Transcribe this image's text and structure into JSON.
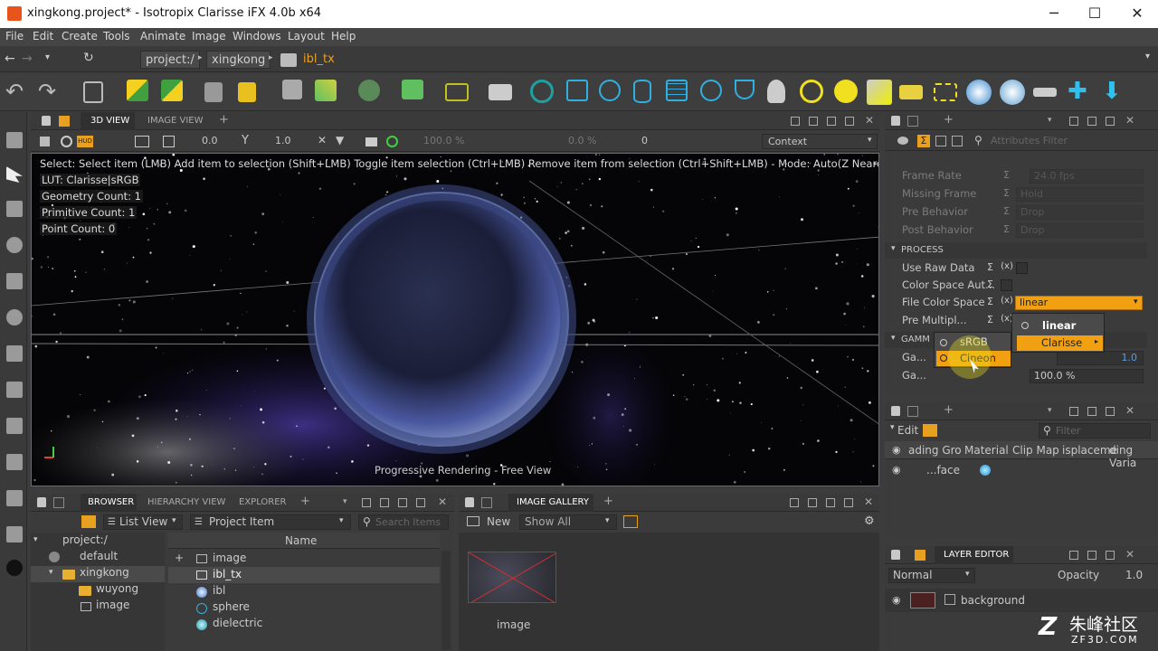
{
  "window": {
    "title": "xingkong.project* - Isotropix Clarisse iFX 4.0b x64",
    "minimize": "─",
    "maximize": "☐",
    "close": "✕"
  },
  "menu": [
    "File",
    "Edit",
    "Create",
    "Tools",
    "Animate",
    "Image",
    "Windows",
    "Layout",
    "Help"
  ],
  "breadcrumb": {
    "root": "project:/",
    "folder": "xingkong",
    "item": "ibl_tx"
  },
  "viewport_panel": {
    "tabs": [
      "3D VIEW",
      "IMAGE VIEW"
    ],
    "active_tab": "3D VIEW"
  },
  "viewbar": {
    "val1": "0.0",
    "val2": "1.0",
    "zoom": "100.0 %",
    "pct": "0.0 %",
    "frame": "0",
    "context": "Context"
  },
  "viewport": {
    "hint": "Select: Select item (LMB)  Add item to selection (Shift+LMB)  Toggle item selection (Ctrl+LMB)  Remove item from selection (Ctrl+Shift+LMB)  - Mode: Auto(Z Nearest) - Chang",
    "lut": "LUT: Clarisse|sRGB",
    "geometry_count": "Geometry Count: 1",
    "primitive_count": "Primitive Count: 1",
    "point_count": "Point Count: 0",
    "status": "Progressive Rendering - Free View"
  },
  "attributes": {
    "filter_placeholder": "Attributes Filter",
    "rows_top": [
      {
        "label": "Frame Rate",
        "value": "24.0 fps"
      },
      {
        "label": "Missing Frame",
        "value": "Hold"
      },
      {
        "label": "Pre Behavior",
        "value": "Drop"
      },
      {
        "label": "Post Behavior",
        "value": "Drop"
      }
    ],
    "process_header": "PROCESS",
    "use_raw_data": "Use Raw Data",
    "color_space_auto": "Color Space Aut...",
    "file_color_space": "File Color Space",
    "file_color_space_value": "linear",
    "pre_multiplied": "Pre Multipl...",
    "gamma_header": "GAMM",
    "gamma1": "Ga...",
    "gamma2": "Ga...",
    "gamma_value": "1.0",
    "percent_value": "100.0 %",
    "sigma": "Σ",
    "x_mark": "(x)"
  },
  "dropdown_main": {
    "items": [
      "linear",
      "Clarisse"
    ],
    "selected": "linear",
    "highlight": "Clarisse"
  },
  "dropdown_sub": {
    "items": [
      "sRGB",
      "Cineon"
    ],
    "highlight": "Cineon"
  },
  "material_panel": {
    "edit": "Edit",
    "filter_placeholder": "Filter",
    "columns": [
      "ading Gro",
      "Material",
      "Clip Map",
      "isplaceme",
      "ding Varia"
    ],
    "row_label": "...face"
  },
  "browser": {
    "tabs": [
      "BROWSER",
      "HIERARCHY VIEW",
      "EXPLORER"
    ],
    "active_tab": "BROWSER",
    "view_mode": "List View",
    "filter_type": "Project Item",
    "search_placeholder": "Search Items",
    "tree": [
      {
        "label": "project:/"
      },
      {
        "label": "default"
      },
      {
        "label": "xingkong"
      },
      {
        "label": "wuyong"
      },
      {
        "label": "image"
      }
    ],
    "column_name": "Name",
    "items": [
      "image",
      "ibl_tx",
      "ibl",
      "sphere",
      "dielectric"
    ]
  },
  "gallery": {
    "tab": "IMAGE GALLERY",
    "new_label": "New",
    "show_label": "Show All",
    "thumb_label": "image"
  },
  "layer_editor": {
    "tab": "LAYER EDITOR",
    "blend": "Normal",
    "opacity_label": "Opacity",
    "opacity_value": "1.0",
    "layer": "background"
  },
  "watermark": {
    "text": "朱峰社区",
    "url": "ZF3D.COM"
  },
  "colors": {
    "accent": "#e8a020",
    "orange_menu": "#f0a010",
    "viewport_bg": "#050508"
  }
}
